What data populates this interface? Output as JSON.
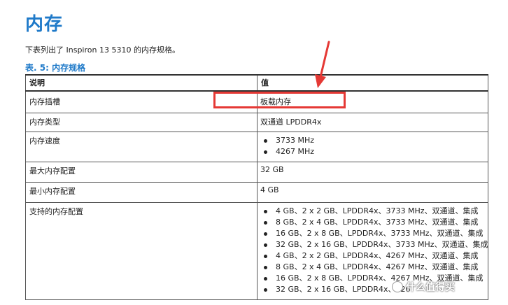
{
  "heading": "内存",
  "intro": "下表列出了 Inspiron 13 5310 的内存规格。",
  "table_caption": "表. 5: 内存规格",
  "table": {
    "headers": [
      "说明",
      "值"
    ],
    "rows": [
      {
        "label": "内存插槽",
        "value": "板载内存"
      },
      {
        "label": "内存类型",
        "value": "双通道 LPDDR4x"
      },
      {
        "label": "内存速度",
        "items": [
          "3733 MHz",
          "4267 MHz"
        ]
      },
      {
        "label": "最大内存配置",
        "value": "32 GB"
      },
      {
        "label": "最小内存配置",
        "value": "4 GB"
      },
      {
        "label": "支持的内存配置",
        "items": [
          "4 GB、2 x 2 GB、LPDDR4x、3733 MHz、双通道、集成",
          "8 GB、2 x 4 GB、LPDDR4x、3733 MHz、双通道、集成",
          "16 GB、2 x 8 GB、LPDDR4x、3733 MHz、双通道、集成",
          "32 GB、2 x 16 GB、LPDDR4x、3733 MHz、双通道、集成",
          "4 GB、2 x 2 GB、LPDDR4x、4267 MHz、双通道、集成",
          "8 GB、2 x 4 GB、LPDDR4x、4267 MHz、双通道、集成",
          "16 GB、2 x 8 GB、LPDDR4x、4267 MHz、双通道、集成",
          "32 GB、2 x 16 GB、LPDDR4x、426"
        ]
      }
    ]
  },
  "annotation": {
    "color": "#e53935"
  },
  "watermark": "什么值得买",
  "colors": {
    "heading": "#1f7ac9",
    "border": "#555555"
  }
}
